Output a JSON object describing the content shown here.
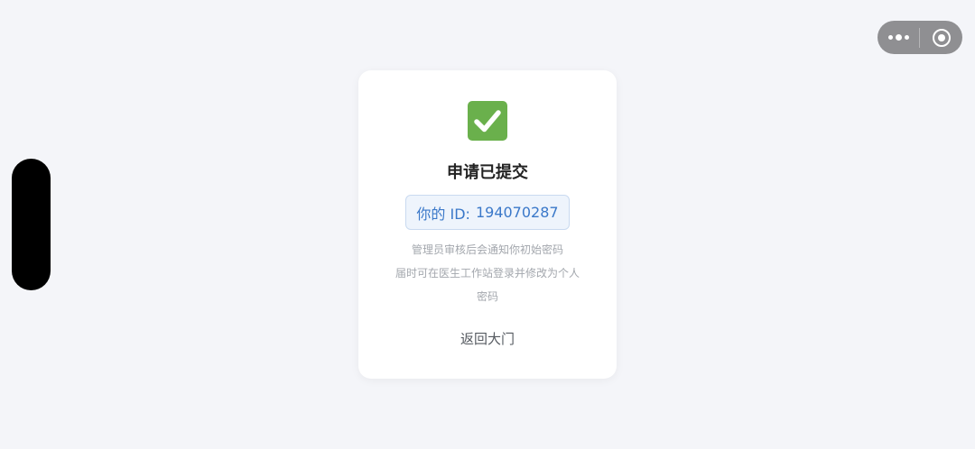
{
  "card": {
    "status_icon": "check-mark-icon",
    "title": "申请已提交",
    "id_label": "你的 ID:",
    "id_value": "194070287",
    "description_lines": [
      "管理员审核后会通知你初始密码",
      "届时可在医生工作站登录并修改为个人",
      "密码"
    ],
    "back_link": "返回大门"
  },
  "capsule": {
    "more_icon": "more-dots-icon",
    "close_icon": "close-circle-icon"
  },
  "colors": {
    "background": "#f4f5f9",
    "success_green": "#6ab04c",
    "id_text_blue": "#3a78c9",
    "id_box_bg": "#eef4fc",
    "muted_text": "#a3a7ad"
  }
}
